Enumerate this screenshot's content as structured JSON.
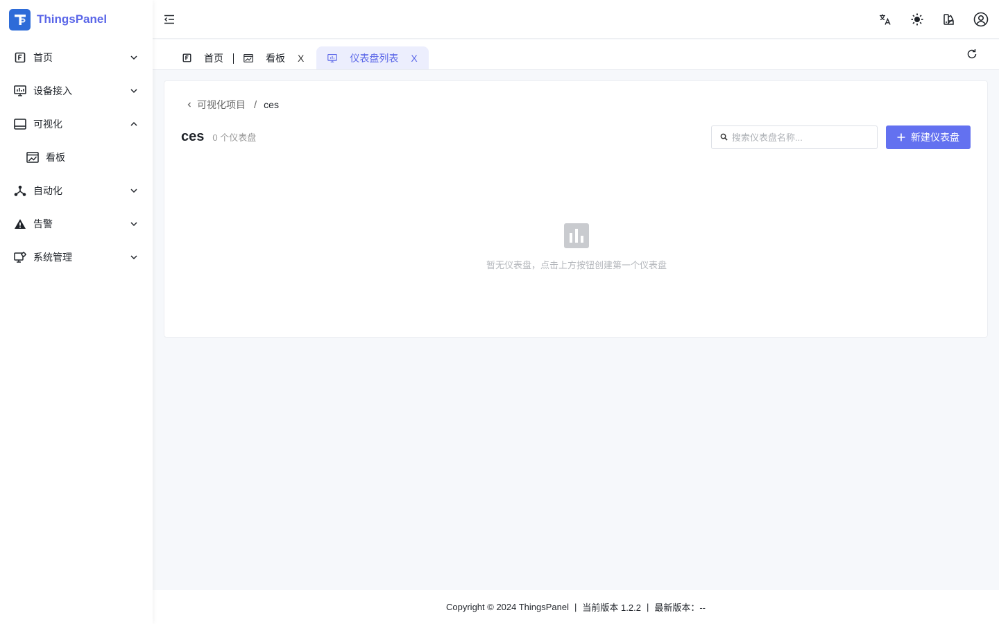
{
  "app": {
    "name": "ThingsPanel"
  },
  "sidebar": {
    "items": [
      {
        "label": "首页",
        "icon": "home-icon",
        "expanded": false
      },
      {
        "label": "设备接入",
        "icon": "monitor-icon",
        "expanded": false
      },
      {
        "label": "可视化",
        "icon": "visualization-icon",
        "expanded": true
      },
      {
        "label": "看板",
        "icon": "dashboard-icon",
        "sub": true
      },
      {
        "label": "自动化",
        "icon": "automation-icon",
        "expanded": false
      },
      {
        "label": "告警",
        "icon": "warning-icon",
        "expanded": false
      },
      {
        "label": "系统管理",
        "icon": "system-settings-icon",
        "expanded": false
      }
    ]
  },
  "tabs": [
    {
      "label": "首页",
      "icon": "home-icon",
      "closable": false
    },
    {
      "label": "看板",
      "icon": "dashboard-icon",
      "closable": true,
      "close": "X"
    },
    {
      "label": "仪表盘列表",
      "icon": "monitor-icon",
      "closable": true,
      "active": true,
      "close": "X"
    }
  ],
  "breadcrumb": {
    "parent": "可视化项目",
    "separator": "/",
    "current": "ces"
  },
  "project": {
    "title": "ces",
    "count_text": "0 个仪表盘"
  },
  "search": {
    "placeholder": "搜索仪表盘名称..."
  },
  "create_button": {
    "label": "新建仪表盘"
  },
  "empty_state": {
    "text": "暂无仪表盘，点击上方按钮创建第一个仪表盘"
  },
  "footer": {
    "copyright": "Copyright © 2024 ThingsPanel",
    "current_version": "当前版本 1.2.2",
    "latest_version": "最新版本：--",
    "separator": "|"
  },
  "colors": {
    "accent": "#6371f0",
    "brand_text": "#5a66e8",
    "logo_bg": "#2d6bd8"
  }
}
